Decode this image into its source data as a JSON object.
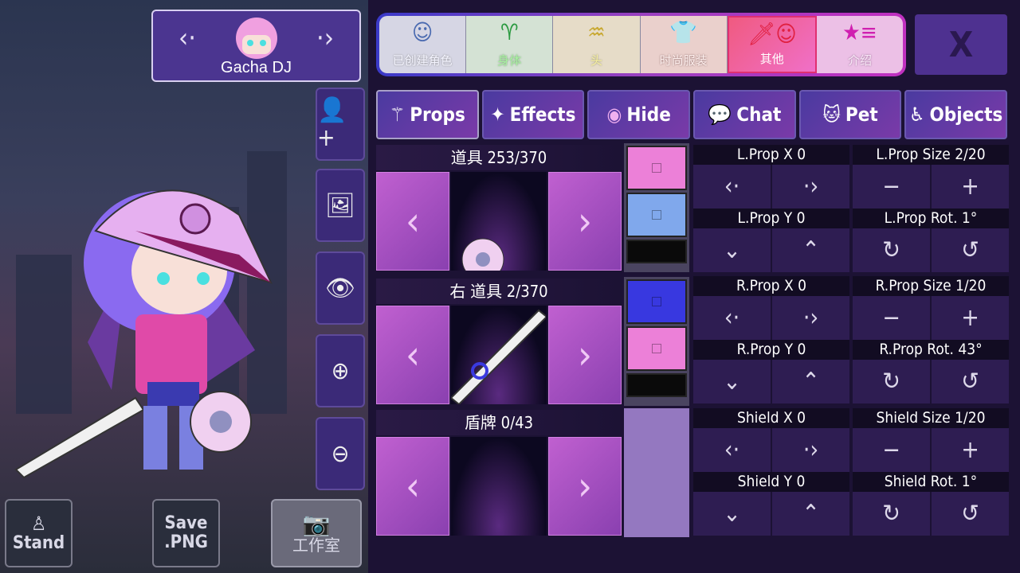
{
  "character": {
    "name": "Gacha DJ",
    "prev_icon": "chevron-left-icon",
    "next_icon": "chevron-right-icon"
  },
  "side_buttons": [
    {
      "icon": "add-user-icon"
    },
    {
      "icon": "image-icon"
    },
    {
      "icon": "eye-icon"
    },
    {
      "icon": "zoom-in-icon"
    },
    {
      "icon": "zoom-out-icon"
    }
  ],
  "bottom_buttons": {
    "stand": "Stand",
    "save_line1": "Save",
    "save_line2": ".PNG",
    "studio": "工作室"
  },
  "main_tabs": [
    {
      "label": "已创建角色",
      "icon": "character-icon",
      "color": "#dde0ee"
    },
    {
      "label": "身体",
      "icon": "body-icon",
      "color": "#b8f0b0"
    },
    {
      "label": "头",
      "icon": "hair-icon",
      "color": "#f5eaa0"
    },
    {
      "label": "时尚服装",
      "icon": "shirt-icon",
      "color": "#f8d8d0"
    },
    {
      "label": "其他",
      "icon": "sword-cat-icon",
      "color": "#ffffff",
      "selected": true
    },
    {
      "label": "介绍",
      "icon": "star-list-icon",
      "color": "#fbe0f5"
    }
  ],
  "close_label": "X",
  "sub_tabs": [
    {
      "label": "Props",
      "icon": "props-icon",
      "selected": true
    },
    {
      "label": "Effects",
      "icon": "sparkle-icon"
    },
    {
      "label": "Hide",
      "icon": "eye-icon"
    },
    {
      "label": "Chat",
      "icon": "chat-icon"
    },
    {
      "label": "Pet",
      "icon": "cat-icon"
    },
    {
      "label": "Objects",
      "icon": "wheelchair-icon"
    }
  ],
  "prop_rows": [
    {
      "label": "道具 253/370",
      "colors": [
        "#ec80d8",
        "#80a8ec",
        "#0a0a0a"
      ]
    },
    {
      "label": "右 道具 2/370",
      "colors": [
        "#3838e0",
        "#ec80d8",
        "#0a0a0a"
      ]
    },
    {
      "label": "盾牌 0/43",
      "colors": []
    }
  ],
  "controls": [
    {
      "pos_x": "L.Prop X 0",
      "pos_y": "L.Prop Y 0",
      "size": "L.Prop Size 2/20",
      "rot": "L.Prop Rot. 1°"
    },
    {
      "pos_x": "R.Prop X 0",
      "pos_y": "R.Prop Y 0",
      "size": "R.Prop Size 1/20",
      "rot": "R.Prop Rot. 43°"
    },
    {
      "pos_x": "Shield X 0",
      "pos_y": "Shield Y 0",
      "size": "Shield Size 1/20",
      "rot": "Shield Rot. 1°"
    }
  ]
}
